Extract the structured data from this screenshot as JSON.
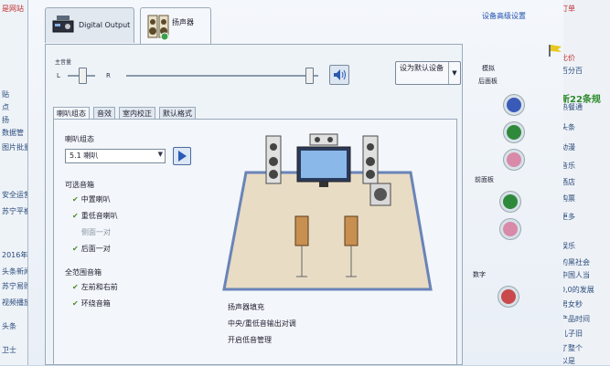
{
  "left_strip": {
    "items": [
      {
        "text": "是网站",
        "red": true
      },
      {
        "text": "贴"
      },
      {
        "text": "点"
      },
      {
        "text": "扬"
      },
      {
        "text": "数据管"
      },
      {
        "text": "图片批量"
      },
      {
        "text": "安全运营"
      },
      {
        "text": "苏宁平板"
      },
      {
        "text": "2016年"
      },
      {
        "text": "头条新闻"
      },
      {
        "text": "苏宁易购"
      },
      {
        "text": "视频播放"
      },
      {
        "text": "头条"
      },
      {
        "text": "卫士"
      }
    ]
  },
  "right_strip": {
    "items": [
      {
        "text": "订单",
        "red": true
      },
      {
        "text": "比价",
        "red": true
      },
      {
        "text": "百分百"
      },
      {
        "text": "新22条规",
        "green": true
      },
      {
        "text": "热餐通"
      },
      {
        "text": "头条"
      },
      {
        "text": "动漫"
      },
      {
        "text": "音乐"
      },
      {
        "text": "酒店"
      },
      {
        "text": "购票"
      },
      {
        "text": "更多"
      },
      {
        "text": "娱乐"
      },
      {
        "text": "的黑社会"
      },
      {
        "text": "中国人当"
      },
      {
        "text": "0,0的发展"
      },
      {
        "text": "男女秒"
      },
      {
        "text": "产品时间"
      },
      {
        "text": "儿子旧"
      },
      {
        "text": "了整个"
      },
      {
        "text": "以是"
      }
    ]
  },
  "device_tabs": [
    {
      "label": "Digital Output",
      "active": false
    },
    {
      "label": "扬声器",
      "active": true
    }
  ],
  "advanced_link": "设备高级设置",
  "volume": {
    "label": "主音量",
    "left": "L",
    "right": "R",
    "level_fraction": 0.95
  },
  "default_button": "设为默认设备",
  "subtabs": [
    "喇叭组态",
    "音效",
    "室内校正",
    "默认格式"
  ],
  "speaker_config": {
    "label": "喇叭组态",
    "selected": "5.1 喇叭"
  },
  "optional_speakers": {
    "title": "可选音箱",
    "items": [
      {
        "label": "中置喇叭",
        "checked": true,
        "disabled": false
      },
      {
        "label": "重低音喇叭",
        "checked": true,
        "disabled": false
      },
      {
        "label": "侧面一对",
        "checked": false,
        "disabled": true
      },
      {
        "label": "后面一对",
        "checked": true,
        "disabled": false
      }
    ]
  },
  "full_range": {
    "title": "全范围音箱",
    "items": [
      {
        "label": "左前和右前",
        "checked": true
      },
      {
        "label": "环绕音箱",
        "checked": true
      }
    ]
  },
  "info_lines": [
    "扬声器填充",
    "中央/重低音输出对调",
    "开启低音管理"
  ],
  "analog": {
    "title": "模拟",
    "back_label": "后面板",
    "front_label": "前面板",
    "digital_label": "数字",
    "back_jacks": [
      "#3a5ab8",
      "#2e8a3a",
      "#d88aa8"
    ],
    "front_jacks": [
      "#2e8a3a",
      "#d88aa8"
    ],
    "digital_jack": "#c84a4a"
  }
}
